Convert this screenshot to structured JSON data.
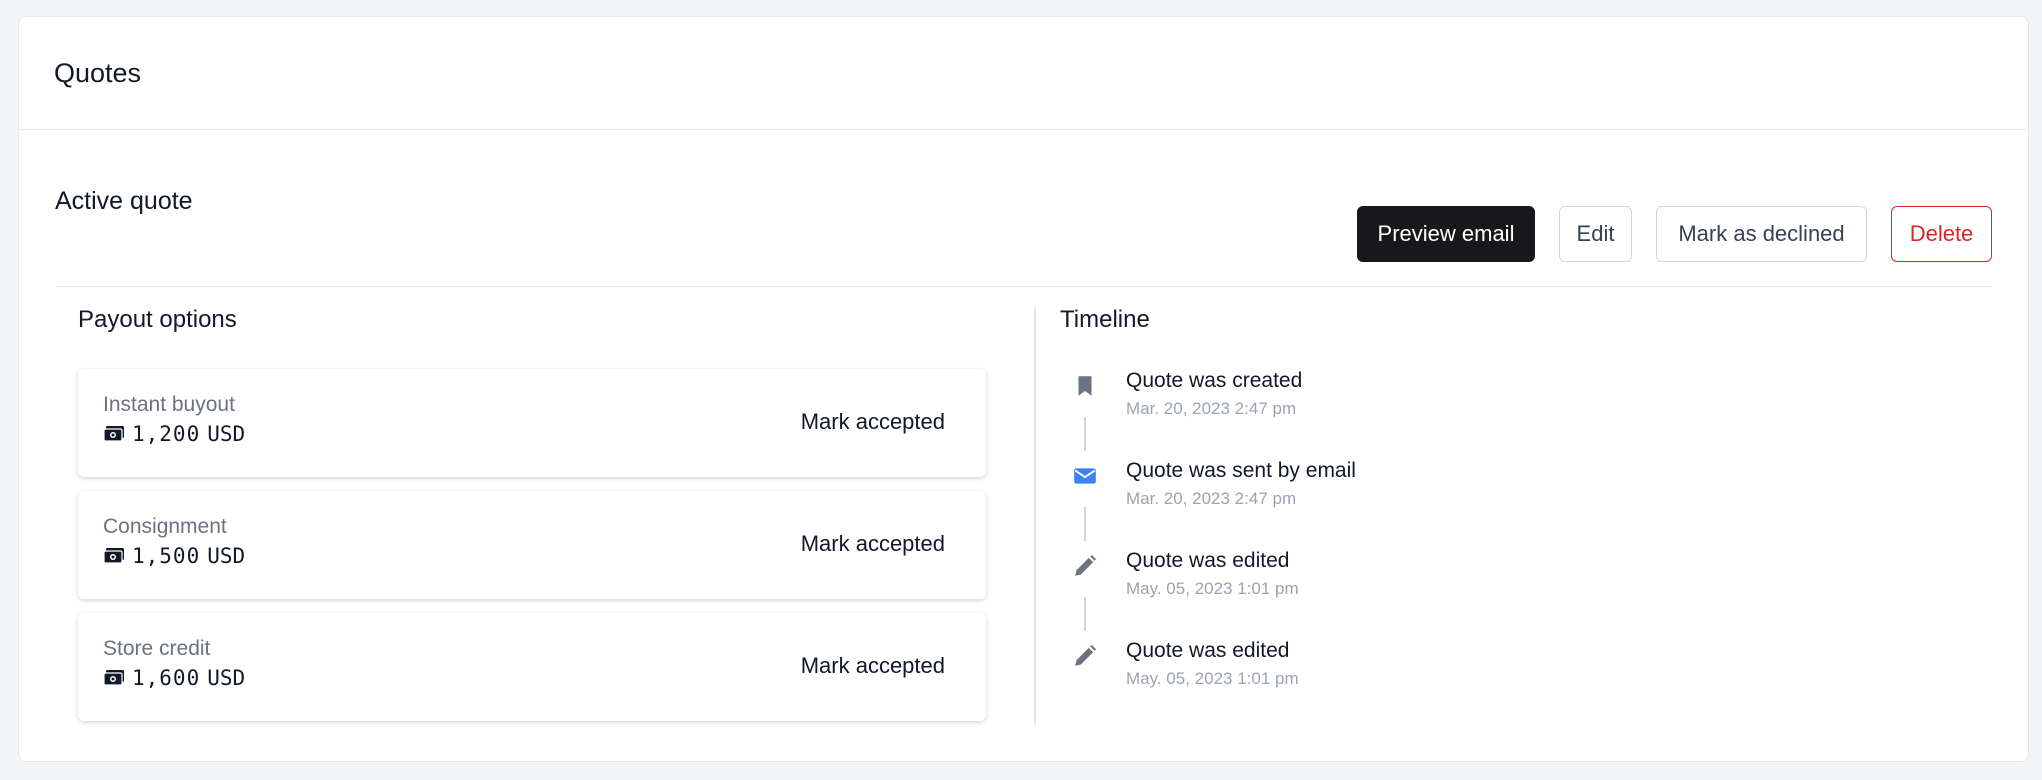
{
  "header": {
    "title": "Quotes"
  },
  "active_quote": {
    "title": "Active quote",
    "actions": {
      "preview_email": "Preview email",
      "edit": "Edit",
      "mark_declined": "Mark as declined",
      "delete": "Delete"
    }
  },
  "payout": {
    "title": "Payout options",
    "options": [
      {
        "name": "Instant buyout",
        "amount": "1,200",
        "currency": "USD",
        "action": "Mark accepted",
        "icon": "money-icon"
      },
      {
        "name": "Consignment",
        "amount": "1,500",
        "currency": "USD",
        "action": "Mark accepted",
        "icon": "money-icon"
      },
      {
        "name": "Store credit",
        "amount": "1,600",
        "currency": "USD",
        "action": "Mark accepted",
        "icon": "money-icon"
      }
    ]
  },
  "timeline": {
    "title": "Timeline",
    "events": [
      {
        "title": "Quote was created",
        "date": "Mar. 20, 2023 2:47 pm",
        "icon": "bookmark-icon"
      },
      {
        "title": "Quote was sent by email",
        "date": "Mar. 20, 2023 2:47 pm",
        "icon": "envelope-icon"
      },
      {
        "title": "Quote was edited",
        "date": "May. 05, 2023 1:01 pm",
        "icon": "pencil-icon"
      },
      {
        "title": "Quote was edited",
        "date": "May. 05, 2023 1:01 pm",
        "icon": "pencil-icon"
      }
    ]
  },
  "colors": {
    "primary_button": "#18181b",
    "danger": "#dc2626",
    "email_icon": "#3b82f6",
    "muted_icon": "#6b7280"
  }
}
